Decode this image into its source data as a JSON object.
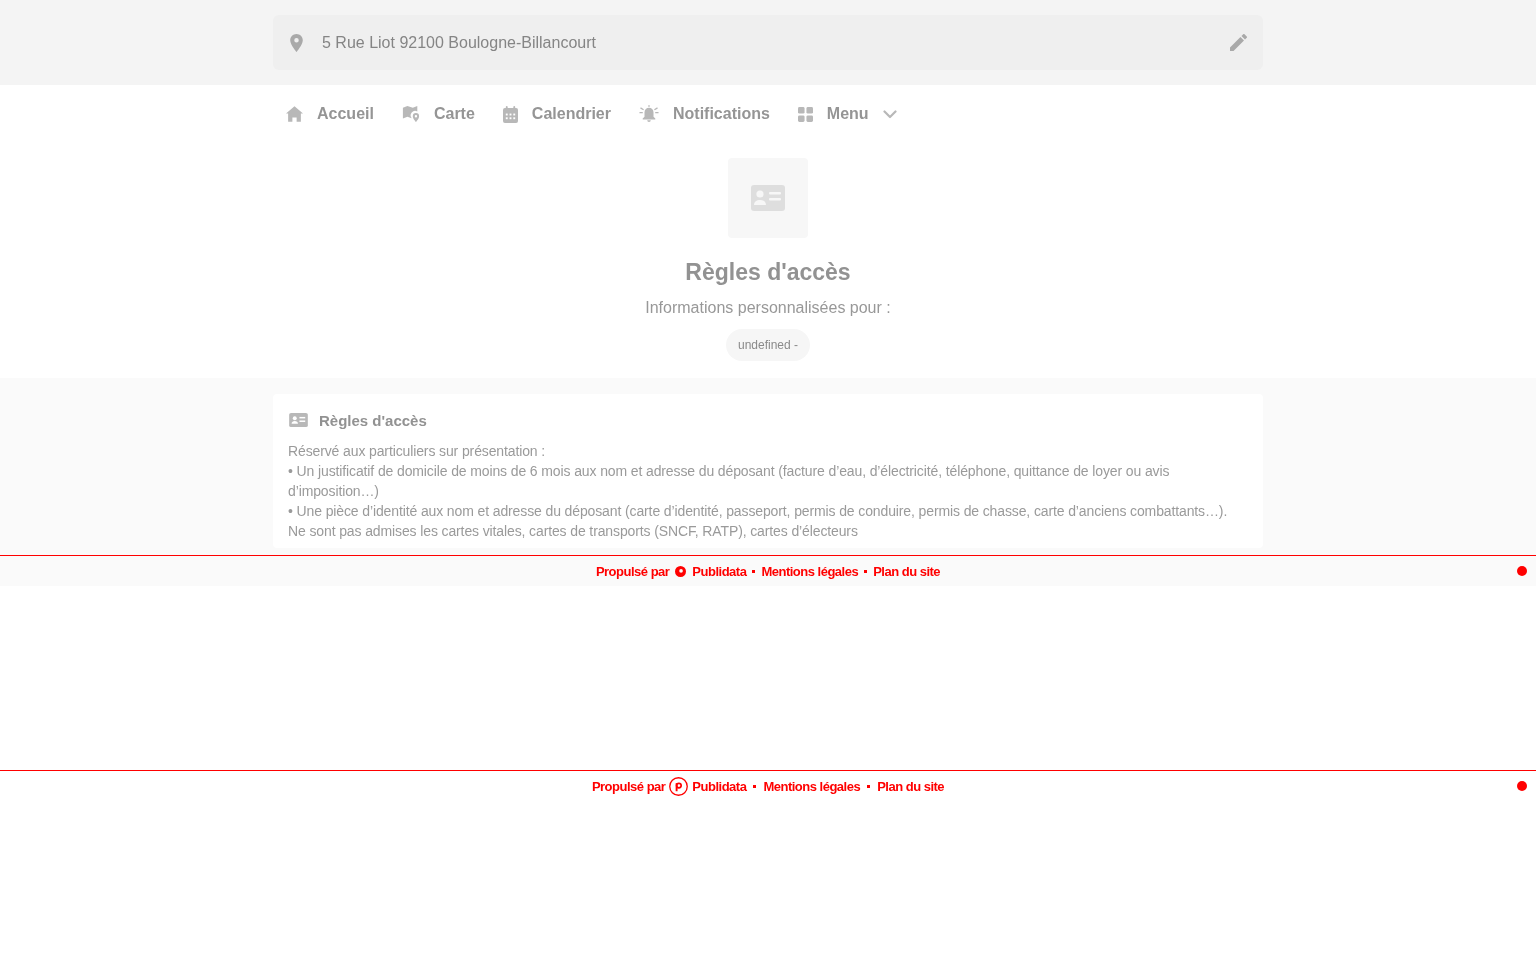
{
  "address_bar": {
    "address": "5 Rue Liot 92100 Boulogne-Billancourt"
  },
  "nav": [
    {
      "kind": "link",
      "label": "Accueil"
    },
    {
      "kind": "link",
      "label": "Carte"
    },
    {
      "kind": "link",
      "label": "Calendrier"
    },
    {
      "kind": "link",
      "label": "Notifications"
    },
    {
      "kind": "dropdown",
      "label": "Menu"
    }
  ],
  "hero": {
    "title": "Règles d'accès",
    "subtitle": "Informations personnalisées pour :",
    "chip": "undefined -"
  },
  "card": {
    "title": "Règles d'accès",
    "lines": [
      "Réservé aux particuliers sur présentation :",
      "• Un justificatif de domicile de moins de 6 mois aux nom et adresse du déposant (facture d’eau, d’électricité, téléphone, quittance de loyer ou avis d’imposition…)",
      "• Une pièce d’identité aux nom et adresse du déposant (carte d’identité, passeport, permis de conduire, permis de chasse, carte d’anciens combattants…). Ne sont pas admises les cartes vitales, cartes de transports (SNCF, RATP), cartes d’électeurs"
    ]
  },
  "footers": [
    {
      "kind": "shaded",
      "powered_by": "Propulsé par",
      "brand": "Publidata",
      "links": [
        "Mentions légales",
        "Plan du site"
      ]
    },
    {
      "kind": "plain",
      "powered_by": "Propulsé par",
      "brand": "Publidata",
      "links": [
        "Mentions légales",
        "Plan du site"
      ]
    }
  ]
}
